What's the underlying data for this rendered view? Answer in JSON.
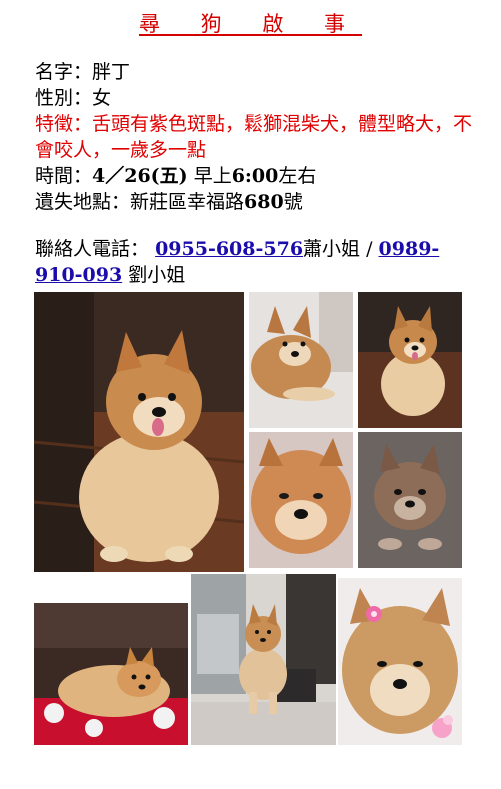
{
  "title": "尋 狗 啟 事",
  "info": {
    "name": "名字：胖丁",
    "gender": "性別：女",
    "features": "特徵：舌頭有紫色斑點，鬆獅混柴犬，體型略大，不會咬人，一歲多一點",
    "time_prefix": "時間：",
    "time_bold": "4／26(五)",
    "time_suffix": " 早上",
    "time_bold2": "6:00",
    "time_end": "左右",
    "location_prefix": "遺失地點：新莊區幸福路",
    "location_bold": "680",
    "location_end": "號"
  },
  "contact": {
    "label": "聯絡人電話：",
    "phone1": "0955-608-576",
    "person1": "蕭小姐 / ",
    "phone2": "0989-910-093",
    "person2": " 劉小姐"
  },
  "colors": {
    "title": "#d40000",
    "feature_text": "#e00000",
    "link": "#1a0dab"
  }
}
